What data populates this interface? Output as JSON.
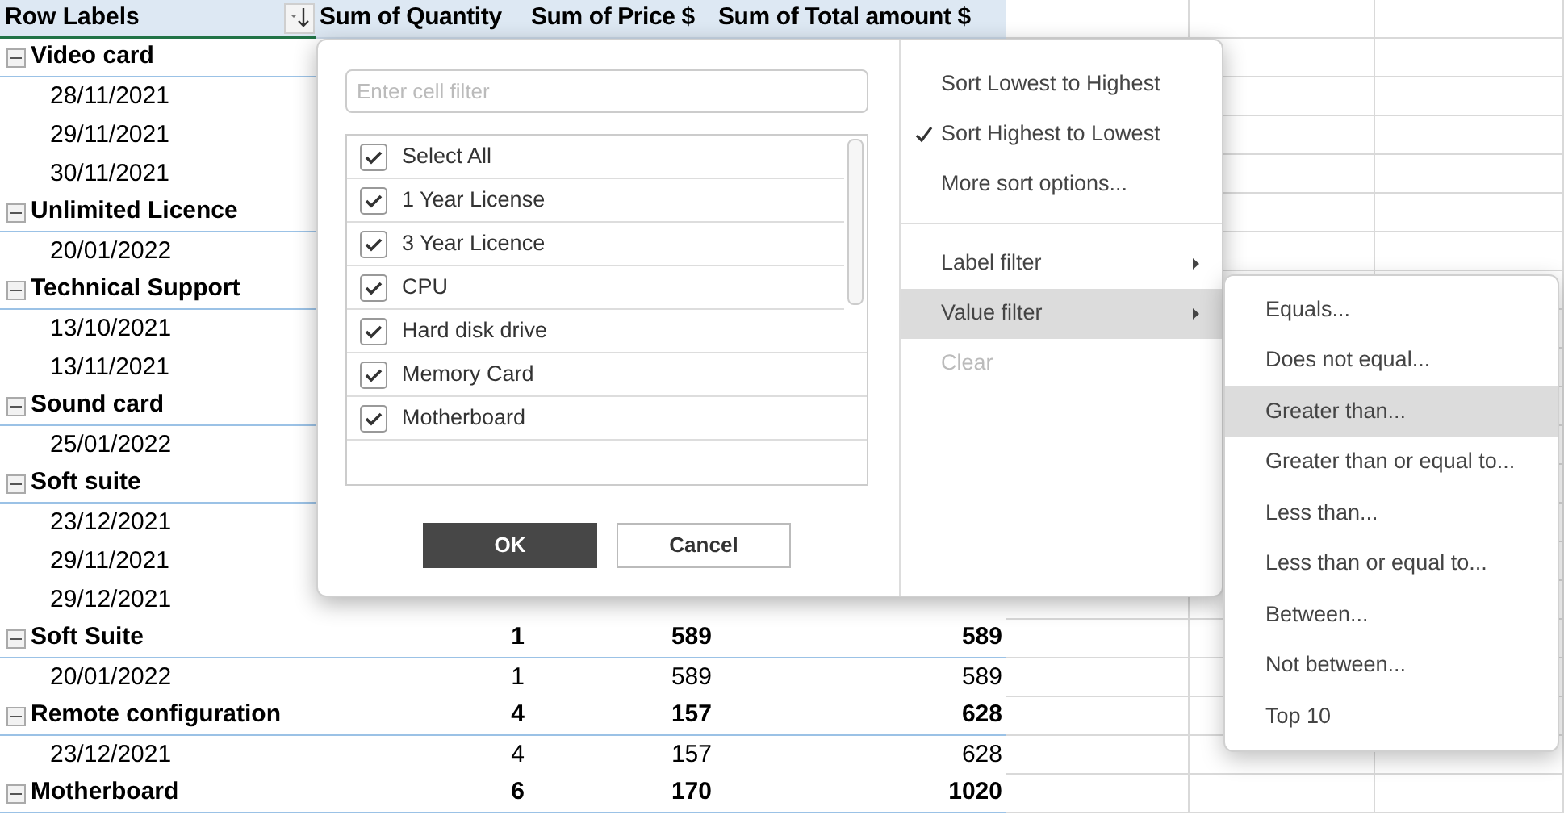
{
  "pivot": {
    "columns": [
      "Row Labels",
      "Sum of Quantity",
      "Sum of Price $",
      "Sum of Total amount $"
    ],
    "rows": [
      {
        "kind": "group",
        "label": "Video card",
        "expanded": true
      },
      {
        "kind": "item",
        "label": "28/11/2021"
      },
      {
        "kind": "item",
        "label": "29/11/2021"
      },
      {
        "kind": "item",
        "label": "30/11/2021"
      },
      {
        "kind": "group",
        "label": "Unlimited Licence",
        "expanded": true
      },
      {
        "kind": "item",
        "label": "20/01/2022"
      },
      {
        "kind": "group",
        "label": "Technical Support",
        "expanded": true
      },
      {
        "kind": "item",
        "label": "13/10/2021"
      },
      {
        "kind": "item",
        "label": "13/11/2021"
      },
      {
        "kind": "group",
        "label": "Sound card",
        "expanded": true
      },
      {
        "kind": "item",
        "label": "25/01/2022"
      },
      {
        "kind": "group",
        "label": "Soft suite",
        "expanded": true
      },
      {
        "kind": "item",
        "label": "23/12/2021"
      },
      {
        "kind": "item",
        "label": "29/11/2021"
      },
      {
        "kind": "item",
        "label": "29/12/2021"
      },
      {
        "kind": "group",
        "label": "Soft Suite",
        "expanded": true,
        "values": [
          "1",
          "589",
          "589"
        ]
      },
      {
        "kind": "item",
        "label": "20/01/2022",
        "values": [
          "1",
          "589",
          "589"
        ]
      },
      {
        "kind": "group",
        "label": "Remote configuration",
        "expanded": true,
        "values": [
          "4",
          "157",
          "628"
        ]
      },
      {
        "kind": "item",
        "label": "23/12/2021",
        "values": [
          "4",
          "157",
          "628"
        ]
      },
      {
        "kind": "group",
        "label": "Motherboard",
        "expanded": true,
        "values": [
          "6",
          "170",
          "1020"
        ]
      }
    ]
  },
  "filter_popup": {
    "search": {
      "placeholder": "Enter cell filter"
    },
    "items": [
      {
        "label": "Select All",
        "checked": true
      },
      {
        "label": "1 Year License",
        "checked": true
      },
      {
        "label": "3 Year Licence",
        "checked": true
      },
      {
        "label": "CPU",
        "checked": true
      },
      {
        "label": "Hard disk drive",
        "checked": true
      },
      {
        "label": "Memory Card",
        "checked": true
      },
      {
        "label": "Motherboard",
        "checked": true
      }
    ],
    "buttons": [
      {
        "label": "OK",
        "kind": "primary"
      },
      {
        "label": "Cancel",
        "kind": "secondary"
      }
    ],
    "sort_items": [
      {
        "label": "Sort Lowest to Highest",
        "checked": false
      },
      {
        "label": "Sort Highest to Lowest",
        "checked": true
      },
      {
        "label": "More sort options...",
        "checked": false
      }
    ],
    "filter_items": [
      {
        "label": "Label filter",
        "selected": false,
        "disabled": false,
        "submenu": true
      },
      {
        "label": "Value filter",
        "selected": true,
        "disabled": false,
        "submenu": true
      },
      {
        "label": "Clear",
        "selected": false,
        "disabled": true,
        "submenu": false
      }
    ]
  },
  "value_filter_submenu": {
    "items": [
      {
        "label": "Equals...",
        "selected": false
      },
      {
        "label": "Does not equal...",
        "selected": false
      },
      {
        "label": "Greater than...",
        "selected": true
      },
      {
        "label": "Greater than or equal to...",
        "selected": false
      },
      {
        "label": "Less than...",
        "selected": false
      },
      {
        "label": "Less than or equal to...",
        "selected": false
      },
      {
        "label": "Between...",
        "selected": false
      },
      {
        "label": "Not between...",
        "selected": false
      },
      {
        "label": "Top 10",
        "selected": false
      }
    ]
  }
}
